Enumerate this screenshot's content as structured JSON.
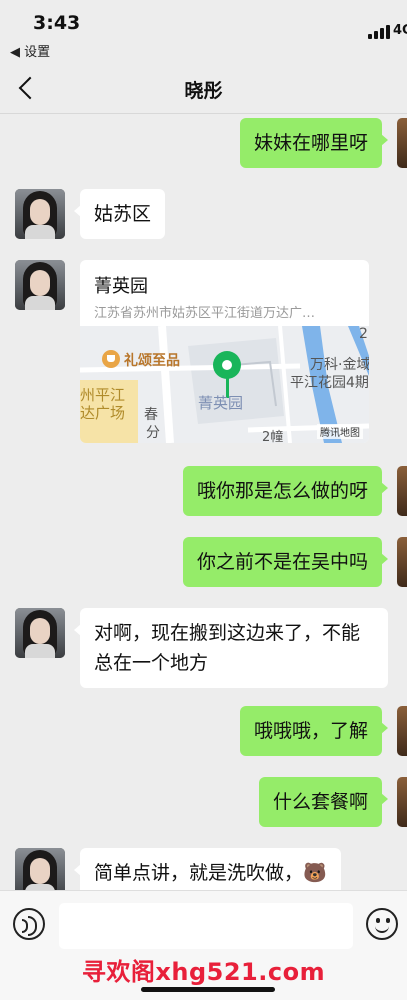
{
  "status": {
    "time": "3:43",
    "back_app": "◀ 设置",
    "network": "4G"
  },
  "header": {
    "title": "晓彤"
  },
  "messages": [
    {
      "side": "right",
      "text": "妹妹在哪里呀"
    },
    {
      "side": "left",
      "text": "姑苏区"
    },
    {
      "side": "left",
      "type": "location",
      "title": "菁英园",
      "address": "江苏省苏州市姑苏区平江街道万达广…"
    },
    {
      "side": "right",
      "text": "哦你那是怎么做的呀"
    },
    {
      "side": "right",
      "text": "你之前不是在吴中吗"
    },
    {
      "side": "left",
      "text": "对啊，现在搬到这边来了，不能总在一个地方"
    },
    {
      "side": "right",
      "text": "哦哦哦，了解"
    },
    {
      "side": "right",
      "text": "什么套餐啊"
    },
    {
      "side": "left",
      "text": "简单点讲，就是洗吹做，🐻"
    }
  ],
  "map": {
    "poi_1": "礼颂至品",
    "pin_label": "菁英园",
    "label_wanke": "万科·金域",
    "label_pingjiang_garden": "平江花园4期",
    "label_wanda_1": "州平江",
    "label_wanda_2": "达广场",
    "label_chun": "春",
    "label_fen": "分",
    "label_building": "2幢",
    "label_num": "2",
    "provider": "腾讯地图"
  },
  "watermark": "寻欢阁xhg521.com",
  "colors": {
    "sent_bubble": "#95ec69",
    "received_bubble": "#ffffff",
    "pin": "#19b55a",
    "watermark": "#e8203a"
  }
}
